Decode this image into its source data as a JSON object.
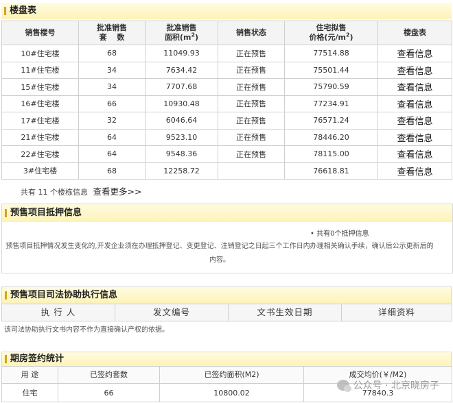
{
  "listing": {
    "title": "楼盘表",
    "headers": {
      "building": "销售楼号",
      "units": "批准销售套　数",
      "area": "批准销售面积(m²)",
      "status": "销售状态",
      "price": "住宅拟售价格(元/m²)",
      "table": "楼盘表"
    },
    "rows": [
      {
        "building": "10#住宅楼",
        "units": "68",
        "area": "11049.93",
        "status": "正在预售",
        "price": "77514.88",
        "link": "查看信息"
      },
      {
        "building": "11#住宅楼",
        "units": "34",
        "area": "7634.42",
        "status": "正在预售",
        "price": "75501.44",
        "link": "查看信息"
      },
      {
        "building": "15#住宅楼",
        "units": "34",
        "area": "7707.68",
        "status": "正在预售",
        "price": "75790.59",
        "link": "查看信息"
      },
      {
        "building": "16#住宅楼",
        "units": "66",
        "area": "10930.48",
        "status": "正在预售",
        "price": "77234.91",
        "link": "查看信息"
      },
      {
        "building": "17#住宅楼",
        "units": "32",
        "area": "6046.64",
        "status": "正在预售",
        "price": "76571.24",
        "link": "查看信息"
      },
      {
        "building": "21#住宅楼",
        "units": "64",
        "area": "9523.10",
        "status": "正在预售",
        "price": "78446.20",
        "link": "查看信息"
      },
      {
        "building": "22#住宅楼",
        "units": "64",
        "area": "9548.36",
        "status": "正在预售",
        "price": "78115.00",
        "link": "查看信息"
      },
      {
        "building": "3#住宅楼",
        "units": "68",
        "area": "12258.72",
        "status": "",
        "price": "76618.81",
        "link": "查看信息"
      }
    ],
    "summary": "共有 11 个楼栋信息",
    "more": "查看更多>>"
  },
  "mortgage": {
    "title": "预售项目抵押信息",
    "count": "• 共有0个抵押信息",
    "note": "预售项目抵押情况发生变化的,开发企业须在办理抵押登记、变更登记、注销登记之日起三个工作日内办理相关确认手续，确认后公示更新后的内容。"
  },
  "judicial": {
    "title": "预售项目司法协助执行信息",
    "headers": [
      "执 行 人",
      "发文编号",
      "文书生效日期",
      "详细资料"
    ],
    "note": "该司法协助执行文书内容不作为直接确认产权的依据。"
  },
  "contract": {
    "title": "期房签约统计",
    "headers": [
      "用 途",
      "已签约套数",
      "已签约面积(M2)",
      "成交均价(￥/M2)"
    ],
    "row": [
      "住宅",
      "66",
      "10800.02",
      "77840.3"
    ]
  },
  "watermark": {
    "text": "公众号 · 北京晓房子",
    "icon": "wechat-icon"
  }
}
